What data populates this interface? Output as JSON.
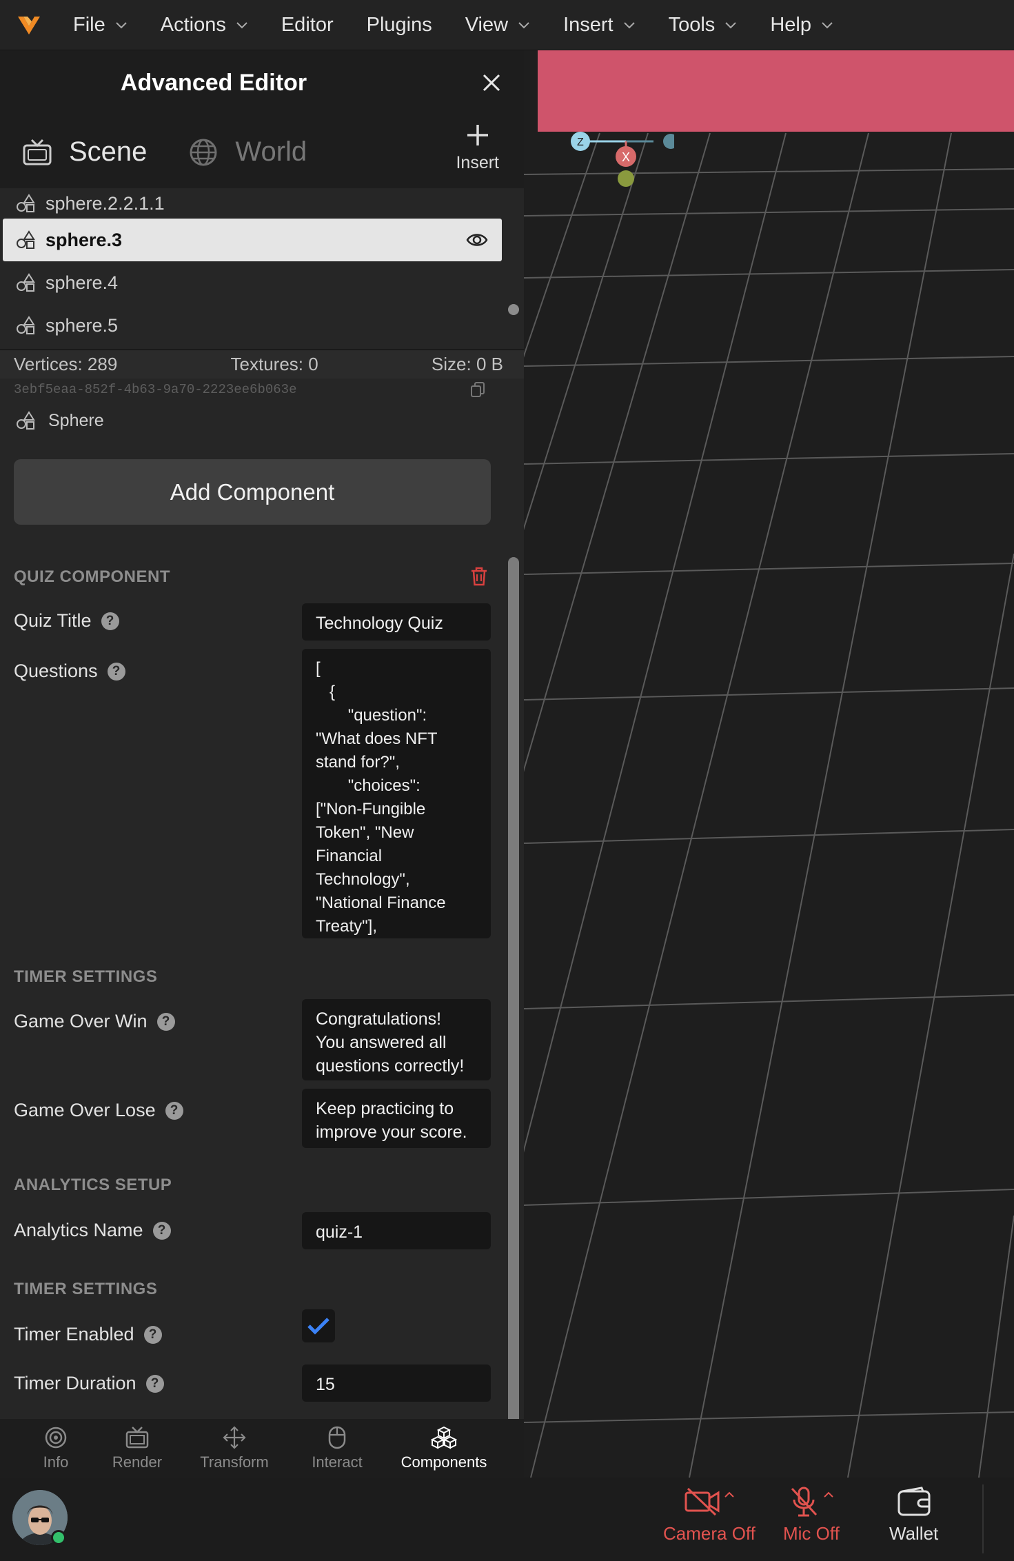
{
  "menu": {
    "items": [
      "File",
      "Actions",
      "Editor",
      "Plugins",
      "View",
      "Insert",
      "Tools",
      "Help"
    ],
    "has_dropdown": [
      true,
      true,
      false,
      false,
      true,
      true,
      true,
      true
    ]
  },
  "panel": {
    "title": "Advanced Editor",
    "tabs": {
      "scene": "Scene",
      "world": "World",
      "insert": "Insert"
    },
    "tree": [
      {
        "label": "sphere.2.2.1.1",
        "selected": false
      },
      {
        "label": "sphere.3",
        "selected": true
      },
      {
        "label": "sphere.4",
        "selected": false
      },
      {
        "label": "sphere.5",
        "selected": false
      }
    ],
    "stats": {
      "vertices": "Vertices: 289",
      "textures": "Textures: 0",
      "size": "Size: 0 B"
    },
    "uuid": "3ebf5eaa-852f-4b63-9a70-2223ee6b063e",
    "entity_type": "Sphere",
    "add_component": "Add Component"
  },
  "quiz": {
    "section": "QUIZ COMPONENT",
    "title_label": "Quiz Title",
    "title_value": "Technology Quiz",
    "questions_label": "Questions",
    "questions_value": "[\n   {\n       \"question\":\n\"What does NFT\nstand for?\",\n       \"choices\":\n[\"Non-Fungible\nToken\", \"New\nFinancial\nTechnology\",\n\"National Finance\nTreaty\"],"
  },
  "timer_section_1": "TIMER SETTINGS",
  "game_over": {
    "win_label": "Game Over Win",
    "win_value": "Congratulations!\nYou answered all\nquestions correctly!",
    "lose_label": "Game Over Lose",
    "lose_value": "Keep practicing to\nimprove your score."
  },
  "analytics": {
    "section": "ANALYTICS SETUP",
    "name_label": "Analytics Name",
    "name_value": "quiz-1"
  },
  "timer": {
    "section": "TIMER SETTINGS",
    "enabled_label": "Timer Enabled",
    "enabled": true,
    "duration_label": "Timer Duration",
    "duration_value": "15"
  },
  "bottom_tabs": [
    {
      "label": "Info",
      "icon": "info-icon",
      "active": false
    },
    {
      "label": "Render",
      "icon": "render-icon",
      "active": false
    },
    {
      "label": "Transform",
      "icon": "transform-icon",
      "active": false
    },
    {
      "label": "Interact",
      "icon": "mouse-icon",
      "active": false
    },
    {
      "label": "Components",
      "icon": "components-icon",
      "active": true
    }
  ],
  "statusbar": {
    "camera": "Camera Off",
    "mic": "Mic Off",
    "wallet": "Wallet"
  },
  "gizmo": {
    "x_label": "X",
    "z_label": "Z"
  },
  "colors": {
    "accent_off": "#e2534f",
    "viewport_banner": "#cf546b",
    "checkbox": "#3b82f6",
    "logo": "#f08a24"
  }
}
